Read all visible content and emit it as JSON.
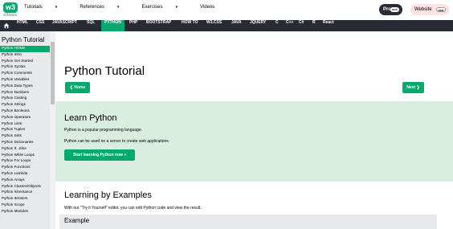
{
  "header": {
    "logo_mark": "w3",
    "logo_text": "schools",
    "menu": [
      "Tutorials",
      "References",
      "Exercises",
      "Videos"
    ],
    "menu_has_caret": [
      true,
      true,
      true,
      false
    ],
    "pro_label": "Pro",
    "pro_badge": "NEW",
    "website_label": "Website",
    "website_badge": "NEW"
  },
  "navbar": {
    "items": [
      "HTML",
      "CSS",
      "JAVASCRIPT",
      "SQL",
      "PYTHON",
      "PHP",
      "BOOTSTRAP",
      "HOW TO",
      "W3.CSS",
      "JAVA",
      "JQUERY",
      "C",
      "C++",
      "C#",
      "R",
      "React"
    ],
    "active": "PYTHON"
  },
  "sidebar": {
    "title": "Python Tutorial",
    "items": [
      "Python HOME",
      "Python Intro",
      "Python Get Started",
      "Python Syntax",
      "Python Comments",
      "Python Variables",
      "Python Data Types",
      "Python Numbers",
      "Python Casting",
      "Python Strings",
      "Python Booleans",
      "Python Operators",
      "Python Lists",
      "Python Tuples",
      "Python Sets",
      "Python Dictionaries",
      "Python If...Else",
      "Python While Loops",
      "Python For Loops",
      "Python Functions",
      "Python Lambda",
      "Python Arrays",
      "Python Classes/Objects",
      "Python Inheritance",
      "Python Iterators",
      "Python Scope",
      "Python Modules"
    ],
    "active": "Python HOME"
  },
  "main": {
    "title": "Python Tutorial",
    "home_button": "❮ Home",
    "next_button": "Next ❯",
    "learn": {
      "title": "Learn Python",
      "p1": "Python is a popular programming language.",
      "p2": "Python can be used on a server to create web applications.",
      "start_button": "Start learning Python now »"
    },
    "examples": {
      "title": "Learning by Examples",
      "p": "With our \"Try it Yourself\" editor, you can edit Python code and view the result.",
      "card_title": "Example"
    }
  },
  "colors": {
    "accent": "#04AA6D",
    "navbar": "#282A35",
    "sidebar": "#E7E9EB",
    "learn_bg": "#D9EEE1"
  }
}
